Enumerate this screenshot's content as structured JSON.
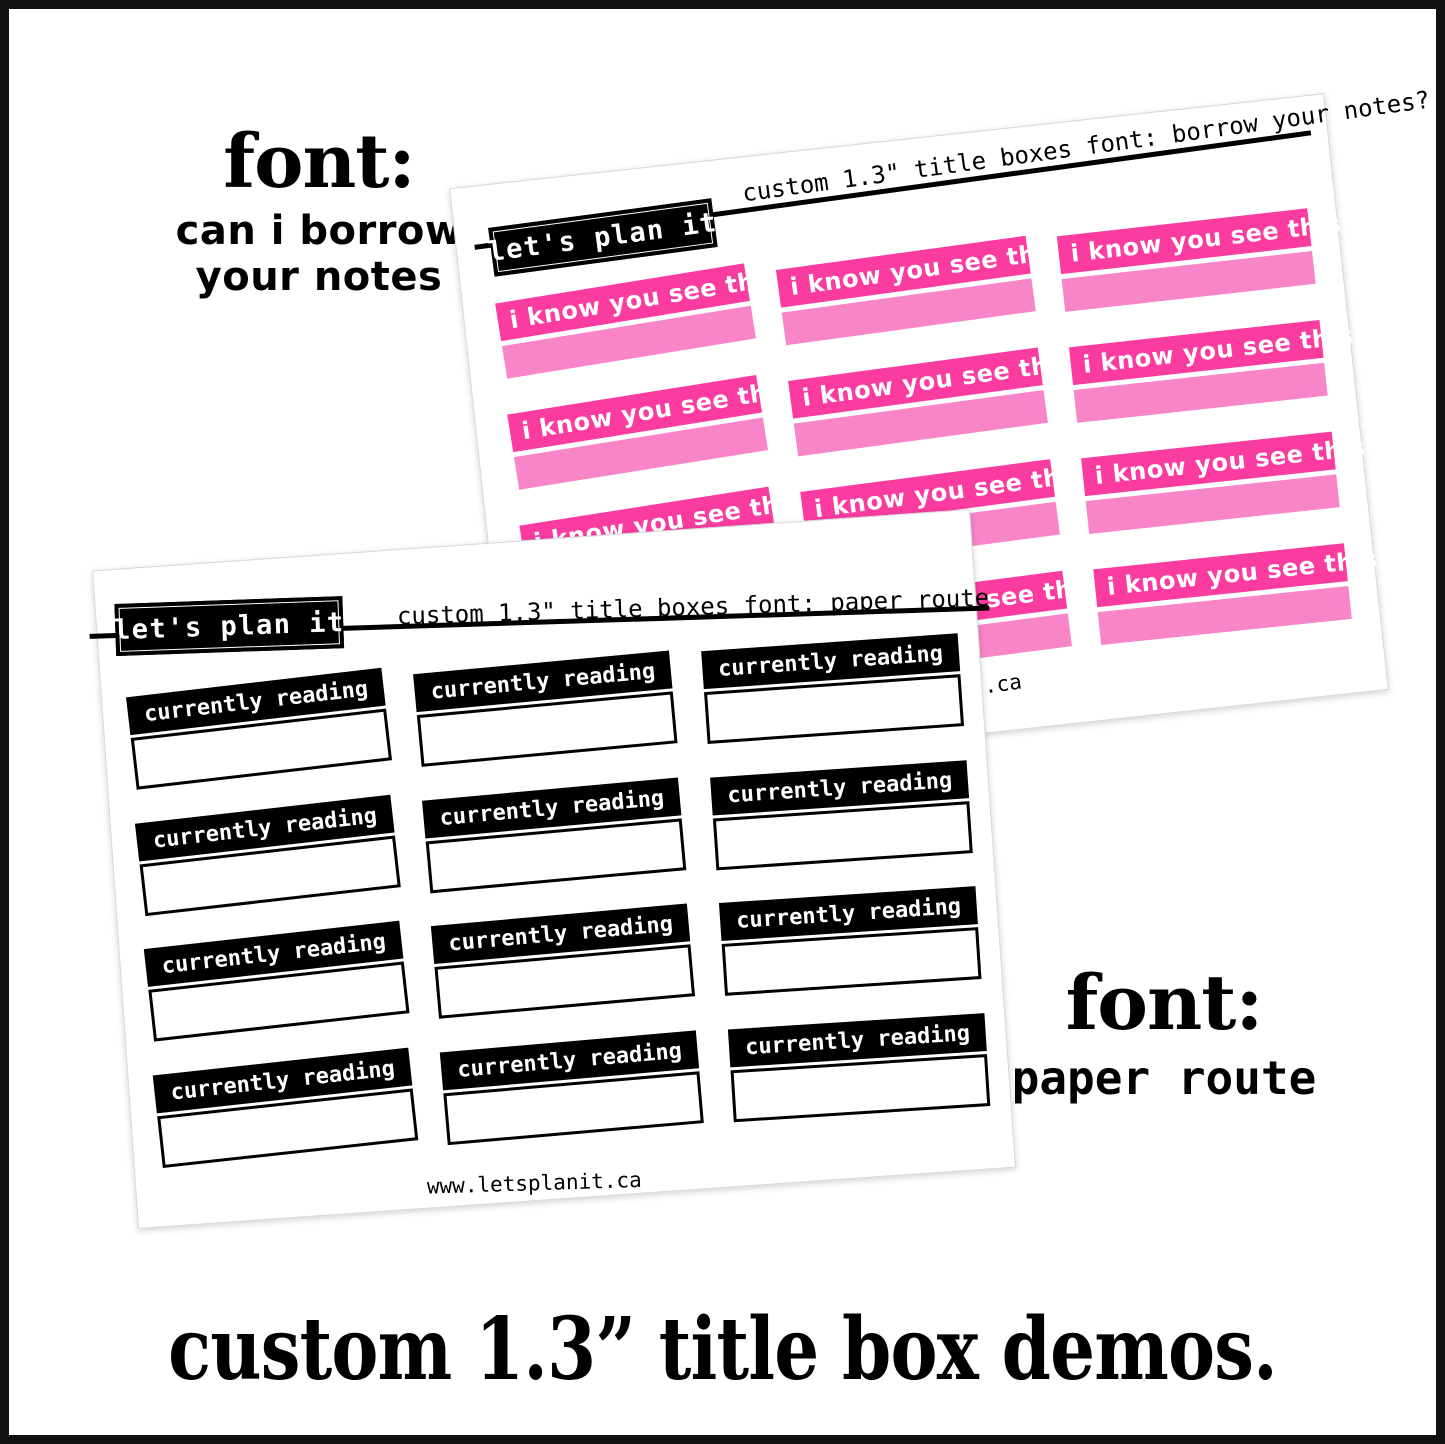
{
  "frame": {
    "border_color": "#111111",
    "page_bg": "#ffffff"
  },
  "captions": {
    "left": {
      "label": "font:",
      "value_line1": "can i borrow",
      "value_line2": "your notes"
    },
    "right": {
      "label": "font:",
      "value": "paper route"
    }
  },
  "bottom_headline": "custom 1.3” title box demos.",
  "sheets": [
    {
      "id": "pink-sheet",
      "logo": "let's plan it",
      "header": "custom 1.3\" title boxes font: borrow your notes?",
      "footer_url": "www.letsplanit.ca",
      "rows": 4,
      "cols": 3,
      "sticker_label": "i know you see this",
      "colors": {
        "title": "#fa3ca0",
        "body": "#f985c9",
        "text": "#ffffff"
      }
    },
    {
      "id": "paper-route-sheet",
      "logo": "let's plan it",
      "header": "custom 1.3\" title boxes font: paper route",
      "footer_url": "www.letsplanit.ca",
      "rows": 4,
      "cols": 3,
      "sticker_label": "currently reading",
      "colors": {
        "title": "#000000",
        "body": "#ffffff",
        "text": "#ffffff",
        "border": "#000000"
      }
    }
  ]
}
